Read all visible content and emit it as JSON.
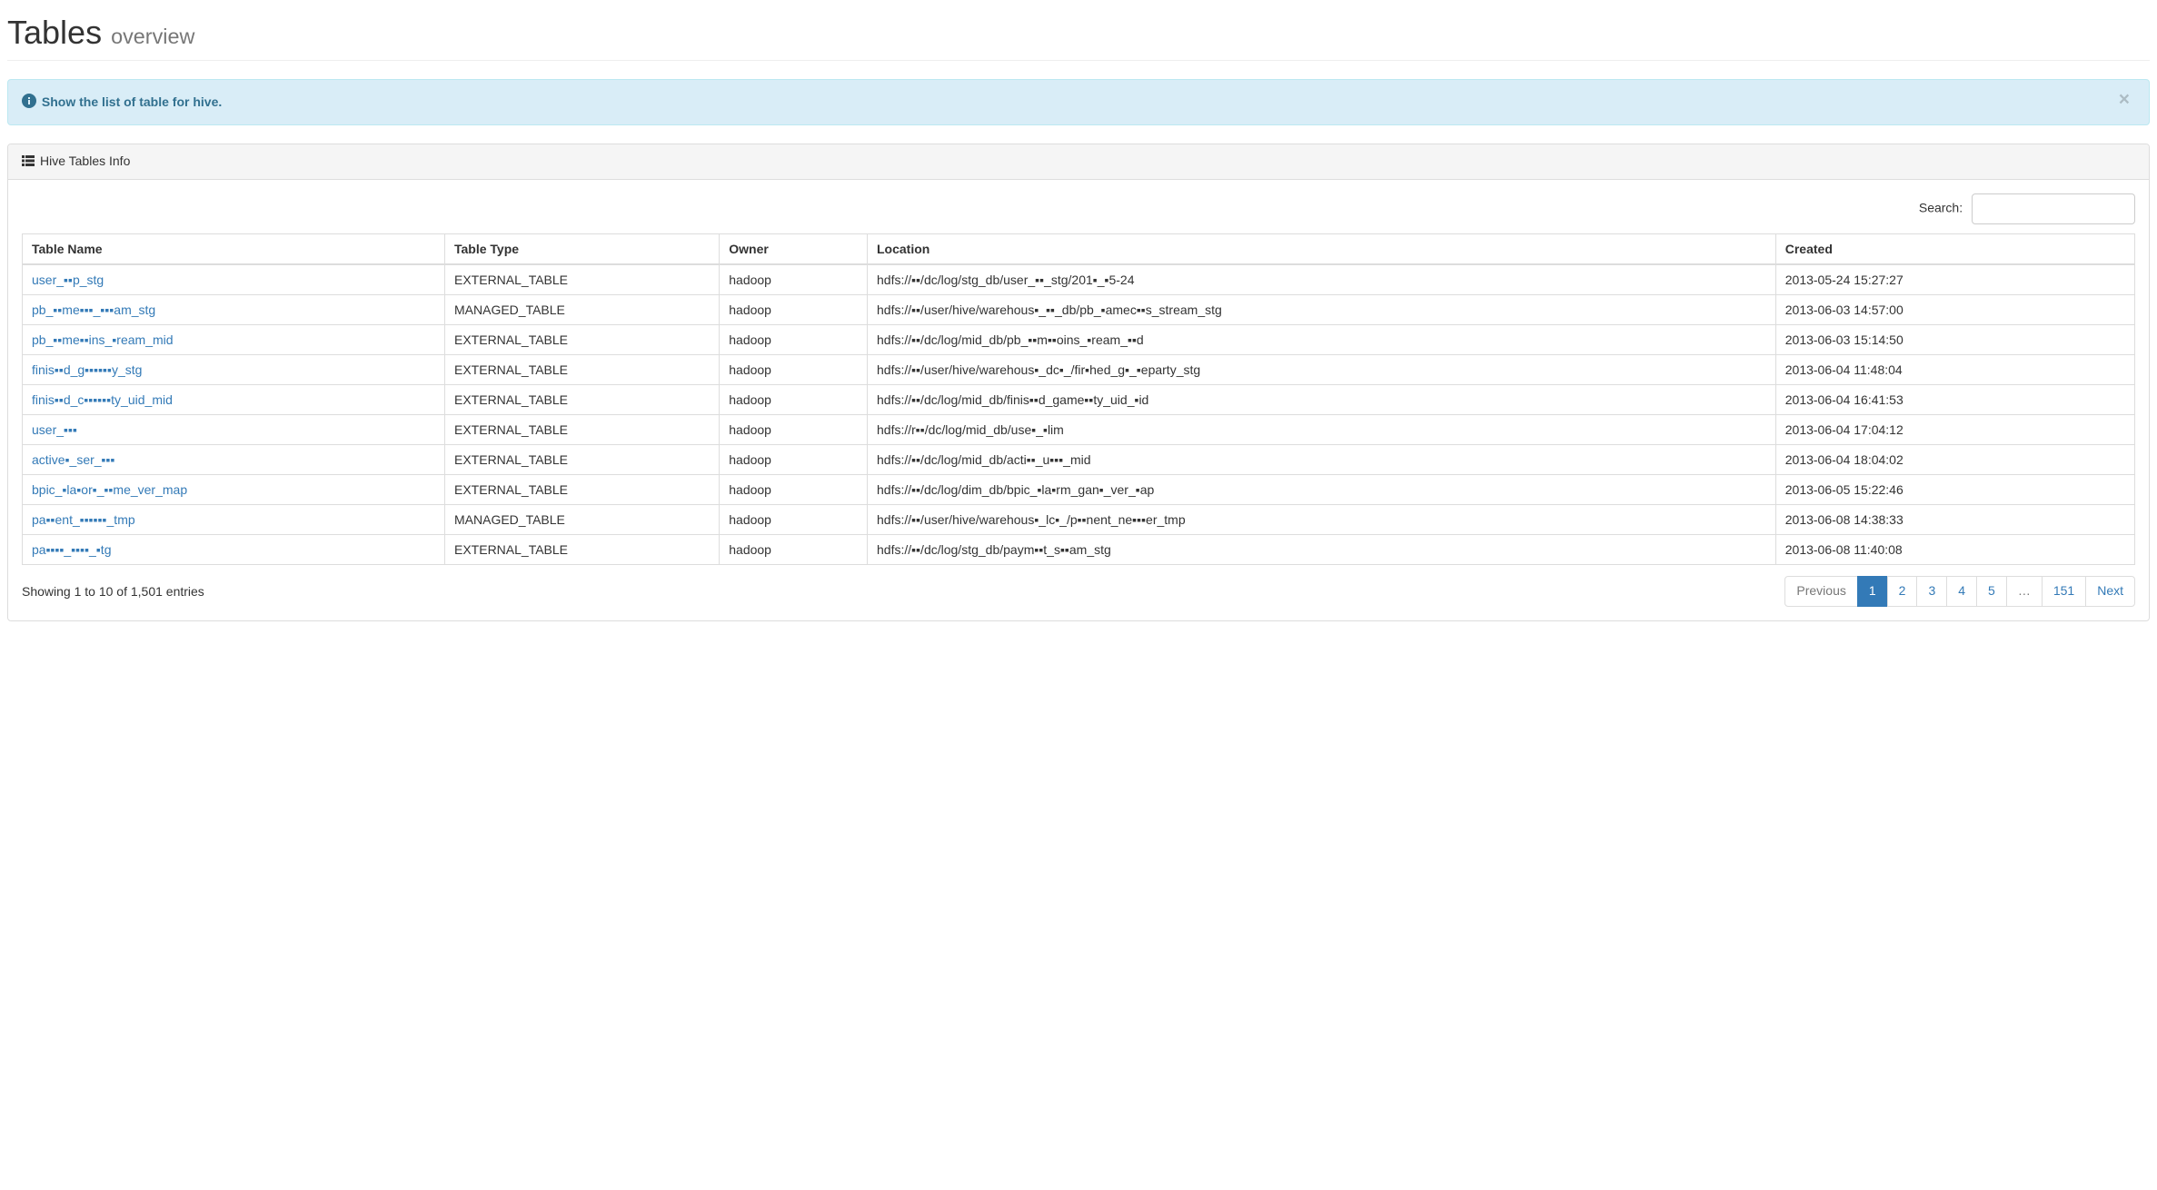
{
  "header": {
    "title": "Tables",
    "subtitle": "overview"
  },
  "alert": {
    "text": "Show the list of table for hive.",
    "close": "×"
  },
  "panel": {
    "title": "Hive Tables Info"
  },
  "search": {
    "label": "Search:",
    "value": ""
  },
  "columns": {
    "name": "Table Name",
    "type": "Table Type",
    "owner": "Owner",
    "location": "Location",
    "created": "Created"
  },
  "rows": [
    {
      "name": "user_▪▪p_stg",
      "type": "EXTERNAL_TABLE",
      "owner": "hadoop",
      "location": "hdfs://▪▪/dc/log/stg_db/user_▪▪_stg/201▪_▪5-24",
      "created": "2013-05-24 15:27:27"
    },
    {
      "name": "pb_▪▪me▪▪▪_▪▪▪am_stg",
      "type": "MANAGED_TABLE",
      "owner": "hadoop",
      "location": "hdfs://▪▪/user/hive/warehous▪_▪▪_db/pb_▪amec▪▪s_stream_stg",
      "created": "2013-06-03 14:57:00"
    },
    {
      "name": "pb_▪▪me▪▪ins_▪ream_mid",
      "type": "EXTERNAL_TABLE",
      "owner": "hadoop",
      "location": "hdfs://▪▪/dc/log/mid_db/pb_▪▪m▪▪oins_▪ream_▪▪d",
      "created": "2013-06-03 15:14:50"
    },
    {
      "name": "finis▪▪d_g▪▪▪▪▪▪y_stg",
      "type": "EXTERNAL_TABLE",
      "owner": "hadoop",
      "location": "hdfs://▪▪/user/hive/warehous▪_dc▪_/fir▪hed_g▪_▪eparty_stg",
      "created": "2013-06-04 11:48:04"
    },
    {
      "name": "finis▪▪d_c▪▪▪▪▪▪ty_uid_mid",
      "type": "EXTERNAL_TABLE",
      "owner": "hadoop",
      "location": "hdfs://▪▪/dc/log/mid_db/finis▪▪d_game▪▪ty_uid_▪id",
      "created": "2013-06-04 16:41:53"
    },
    {
      "name": "user_▪▪▪",
      "type": "EXTERNAL_TABLE",
      "owner": "hadoop",
      "location": "hdfs://r▪▪/dc/log/mid_db/use▪_▪lim",
      "created": "2013-06-04 17:04:12"
    },
    {
      "name": "active▪_ser_▪▪▪",
      "type": "EXTERNAL_TABLE",
      "owner": "hadoop",
      "location": "hdfs://▪▪/dc/log/mid_db/acti▪▪_u▪▪▪_mid",
      "created": "2013-06-04 18:04:02"
    },
    {
      "name": "bpic_▪la▪or▪_▪▪me_ver_map",
      "type": "EXTERNAL_TABLE",
      "owner": "hadoop",
      "location": "hdfs://▪▪/dc/log/dim_db/bpic_▪la▪rm_gan▪_ver_▪ap",
      "created": "2013-06-05 15:22:46"
    },
    {
      "name": "pa▪▪ent_▪▪▪▪▪▪_tmp",
      "type": "MANAGED_TABLE",
      "owner": "hadoop",
      "location": "hdfs://▪▪/user/hive/warehous▪_lc▪_/p▪▪nent_ne▪▪▪er_tmp",
      "created": "2013-06-08 14:38:33"
    },
    {
      "name": "pa▪▪▪▪_▪▪▪▪_▪tg",
      "type": "EXTERNAL_TABLE",
      "owner": "hadoop",
      "location": "hdfs://▪▪/dc/log/stg_db/paym▪▪t_s▪▪am_stg",
      "created": "2013-06-08 11:40:08"
    }
  ],
  "info": "Showing 1 to 10 of 1,501 entries",
  "pagination": {
    "previous": "Previous",
    "next": "Next",
    "ellipsis": "…",
    "pages": [
      "1",
      "2",
      "3",
      "4",
      "5"
    ],
    "last": "151",
    "active": 0
  }
}
